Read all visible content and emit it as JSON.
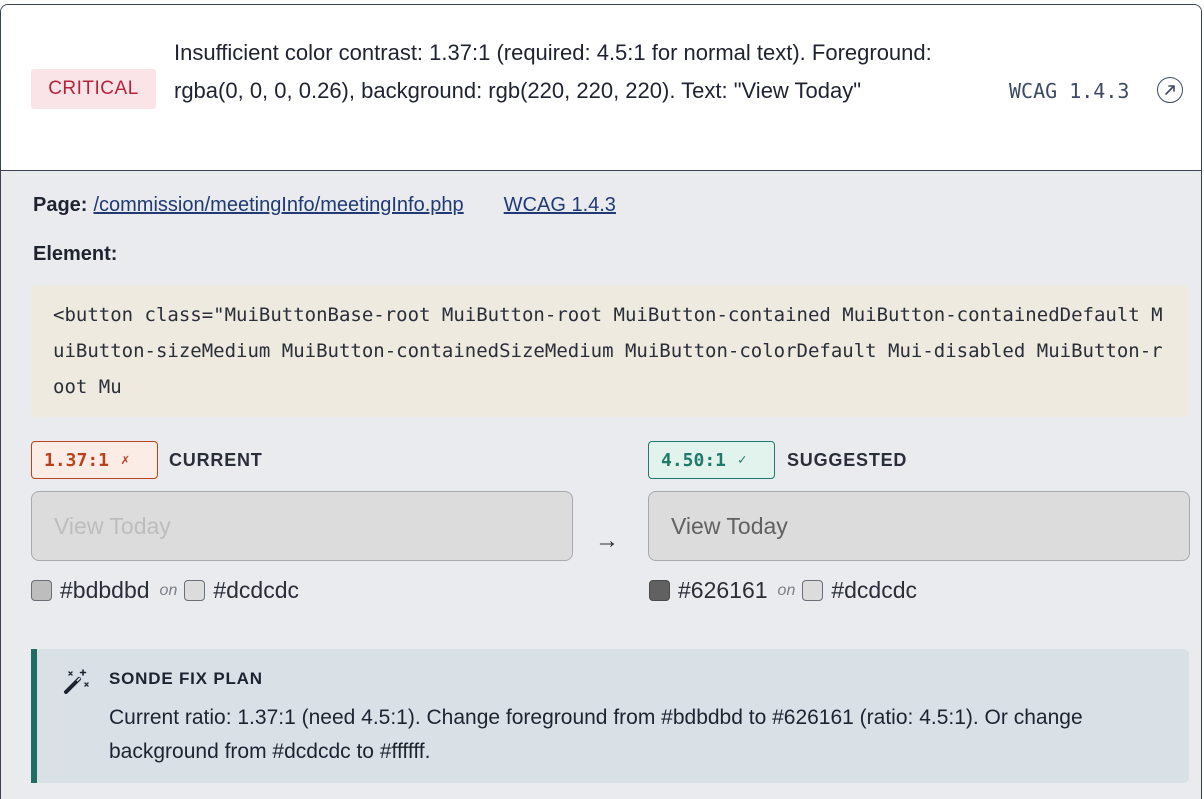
{
  "issue": {
    "severity": "CRITICAL",
    "message": "Insufficient color contrast: 1.37:1 (required: 4.5:1 for normal text). Foreground: rgba(0, 0, 0, 0.26), background: rgb(220, 220, 220). Text: \"View Today\"",
    "wcag_tag": "WCAG 1.4.3",
    "link_icon": "external-link-icon"
  },
  "details": {
    "page_label": "Page:",
    "page_url": "/commission/meetingInfo/meetingInfo.php",
    "wcag_link": "WCAG 1.4.3",
    "element_label": "Element:",
    "element_code": "<button class=\"MuiButtonBase-root MuiButton-root MuiButton-contained MuiButton-containedDefault MuiButton-sizeMedium MuiButton-containedSizeMedium MuiButton-colorDefault Mui-disabled MuiButton-root Mu"
  },
  "current": {
    "ratio": "1.37:1",
    "mark": "✗",
    "label": "CURRENT",
    "preview_text": "View Today",
    "fg": "#bdbdbd",
    "on_word": "on",
    "bg": "#dcdcdc"
  },
  "suggested": {
    "ratio": "4.50:1",
    "mark": "✓",
    "label": "SUGGESTED",
    "preview_text": "View Today",
    "fg": "#626161",
    "on_word": "on",
    "bg": "#dcdcdc"
  },
  "arrow": "→",
  "fix": {
    "icon": "magic-wand-icon",
    "title": "SONDE FIX PLAN",
    "text": "Current ratio: 1.37:1 (need 4.5:1). Change foreground from #bdbdbd to #626161 (ratio: 4.5:1). Or change background from #dcdcdc to #ffffff."
  }
}
